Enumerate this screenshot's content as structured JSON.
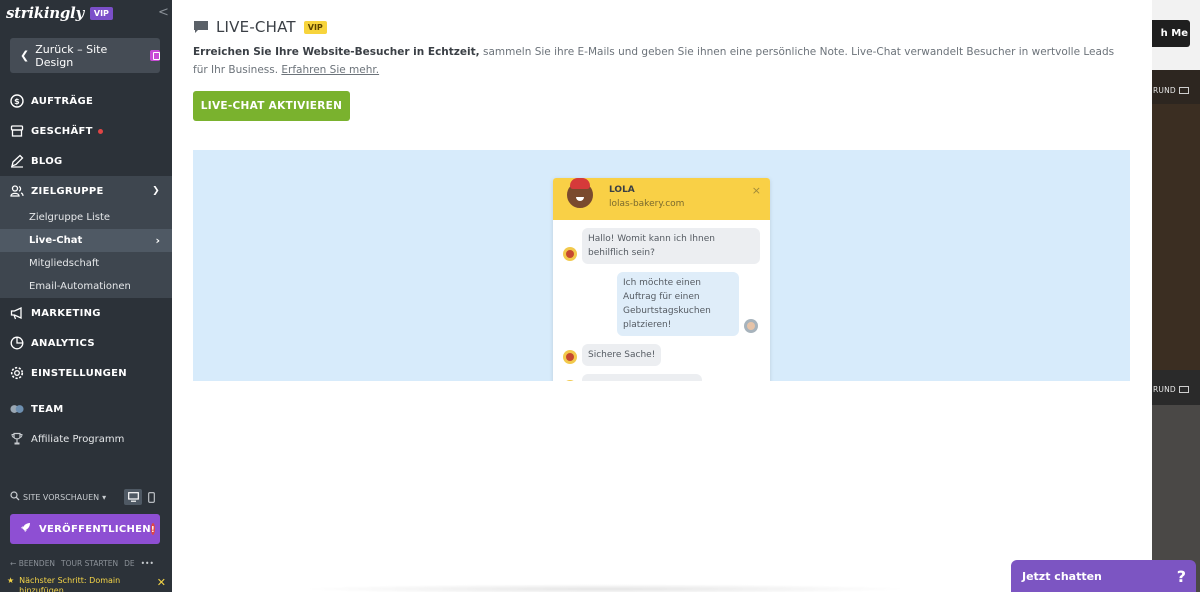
{
  "sidebar": {
    "logo": "strikingly",
    "vip": "VIP",
    "collapse": "<",
    "back_label": "Zurück – Site Design",
    "nav": {
      "auftraege": "AUFTRÄGE",
      "geschaeft": "GESCHÄFT",
      "blog": "BLOG",
      "zielgruppe": "ZIELGRUPPE",
      "marketing": "MARKETING",
      "analytics": "ANALYTICS",
      "einstellungen": "EINSTELLUNGEN",
      "team": "TEAM",
      "affiliate": "Affiliate Programm"
    },
    "sub": {
      "liste": "Zielgruppe Liste",
      "livechat": "Live-Chat",
      "mitglied": "Mitgliedschaft",
      "email": "Email-Automationen"
    },
    "preview_label": "SITE VORSCHAUEN",
    "publish_label": "VERÖFFENTLICHEN",
    "footer": {
      "beenden": "BEENDEN",
      "tour": "TOUR STARTEN",
      "lang": "DE",
      "more": "•••"
    },
    "next_step": "Nächster Schritt: Domain hinzufügen"
  },
  "main": {
    "title": "LIVE-CHAT",
    "vip": "VIP",
    "desc_bold": "Erreichen Sie Ihre Website-Besucher in Echtzeit,",
    "desc_rest": " sammeln Sie ihre E-Mails und geben Sie ihnen eine persönliche Note. Live-Chat verwandelt Besucher in wertvolle Leads für Ihr Business. ",
    "desc_link": "Erfahren Sie mehr.",
    "activate_label": "LIVE-CHAT AKTIVIEREN",
    "widget": {
      "agent_name": "LOLA",
      "agent_site": "lolas-bakery.com",
      "close": "×",
      "msg1": "Hallo! Womit kann ich Ihnen behilflich sein?",
      "msg2": "Ich möchte einen Auftrag für einen Geburtstagskuchen platzieren!",
      "msg3": "Sichere Sache!"
    }
  },
  "right": {
    "touch": "h Me",
    "bg_label_1": "RUND",
    "bg_label_2": "RUND"
  },
  "chat_bar": {
    "label": "Jetzt chatten",
    "help": "?"
  },
  "colors": {
    "sidebar": "#2c3239",
    "accent_green": "#7ab22e",
    "vip_purple": "#7b4fc9",
    "chat_purple": "#7c55c2",
    "widget_yellow": "#f9d046",
    "preview_blue": "#d7ebfb"
  }
}
